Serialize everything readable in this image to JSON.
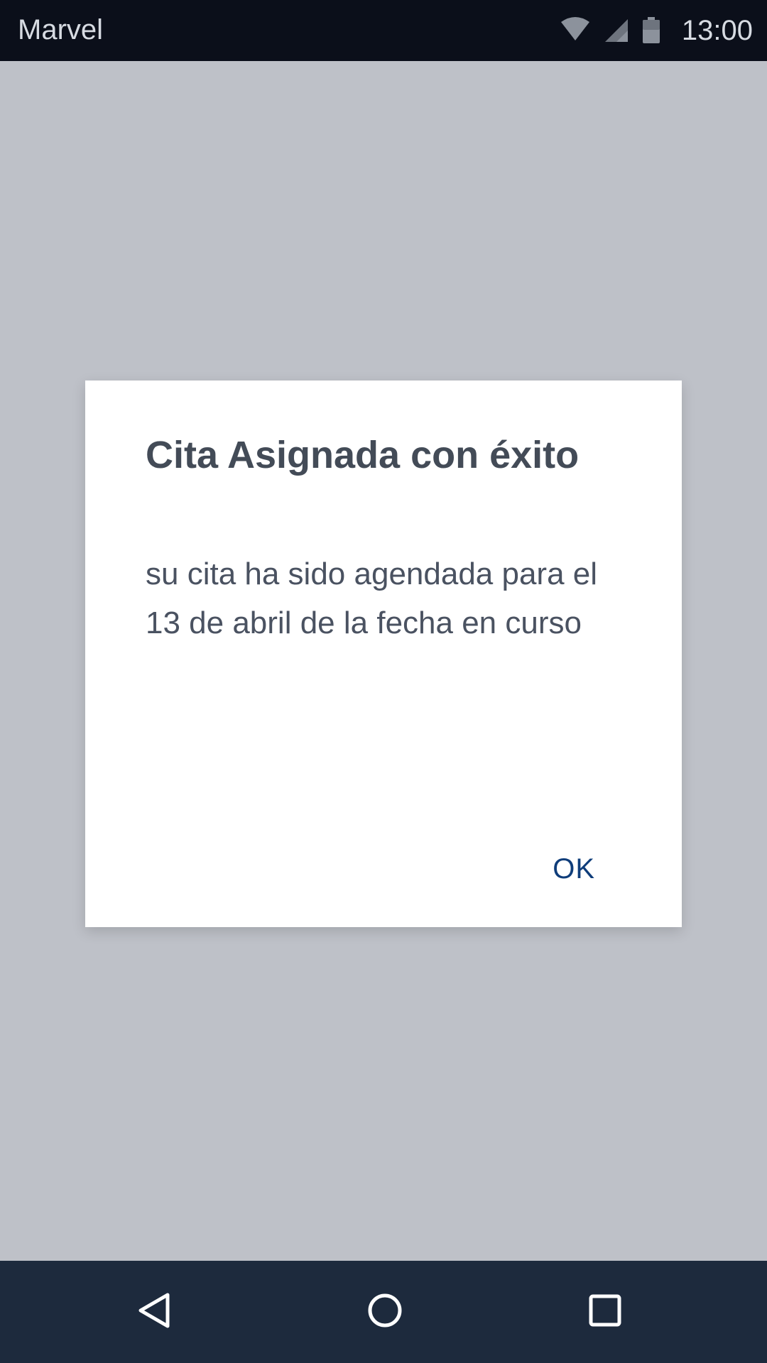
{
  "status_bar": {
    "app_name": "Marvel",
    "time": "13:00",
    "icons": [
      "wifi-icon",
      "signal-icon",
      "battery-icon"
    ]
  },
  "dialog": {
    "title": "Cita Asignada con éxito",
    "message": "su cita ha sido agendada para el 13 de abril de la fecha en curso",
    "ok_label": "OK"
  },
  "nav_bar": {
    "icons": [
      "back-icon",
      "home-icon",
      "recent-apps-icon"
    ]
  },
  "colors": {
    "status_bar_bg": "#0b0f1a",
    "screen_bg": "#bec1c8",
    "dialog_bg": "#ffffff",
    "title_text": "#434b57",
    "accent": "#0f3d7a",
    "nav_bar_bg": "#1d2a3d"
  }
}
